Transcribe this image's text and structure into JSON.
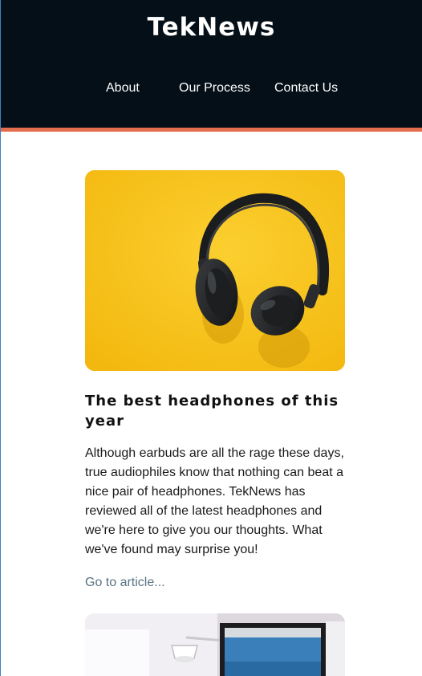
{
  "site": {
    "title": "TekNews"
  },
  "nav": {
    "items": [
      "About",
      "Our Process",
      "Contact Us"
    ]
  },
  "articles": [
    {
      "image_icon": "headphones-photo",
      "title": "The best headphones of this year",
      "body": "Although earbuds are all the rage these days, true audiophiles know that nothing can beat a nice pair of headphones. TekNews has reviewed all of the latest headphones and we're here to give you our thoughts. What we've found may surprise you!",
      "link_text": "Go to article..."
    },
    {
      "image_icon": "desk-monitor-photo"
    }
  ],
  "colors": {
    "header_bg": "#040f17",
    "header_accent": "#e46d4d",
    "link": "#5a7283",
    "image_yellow": "#f8c31a"
  }
}
